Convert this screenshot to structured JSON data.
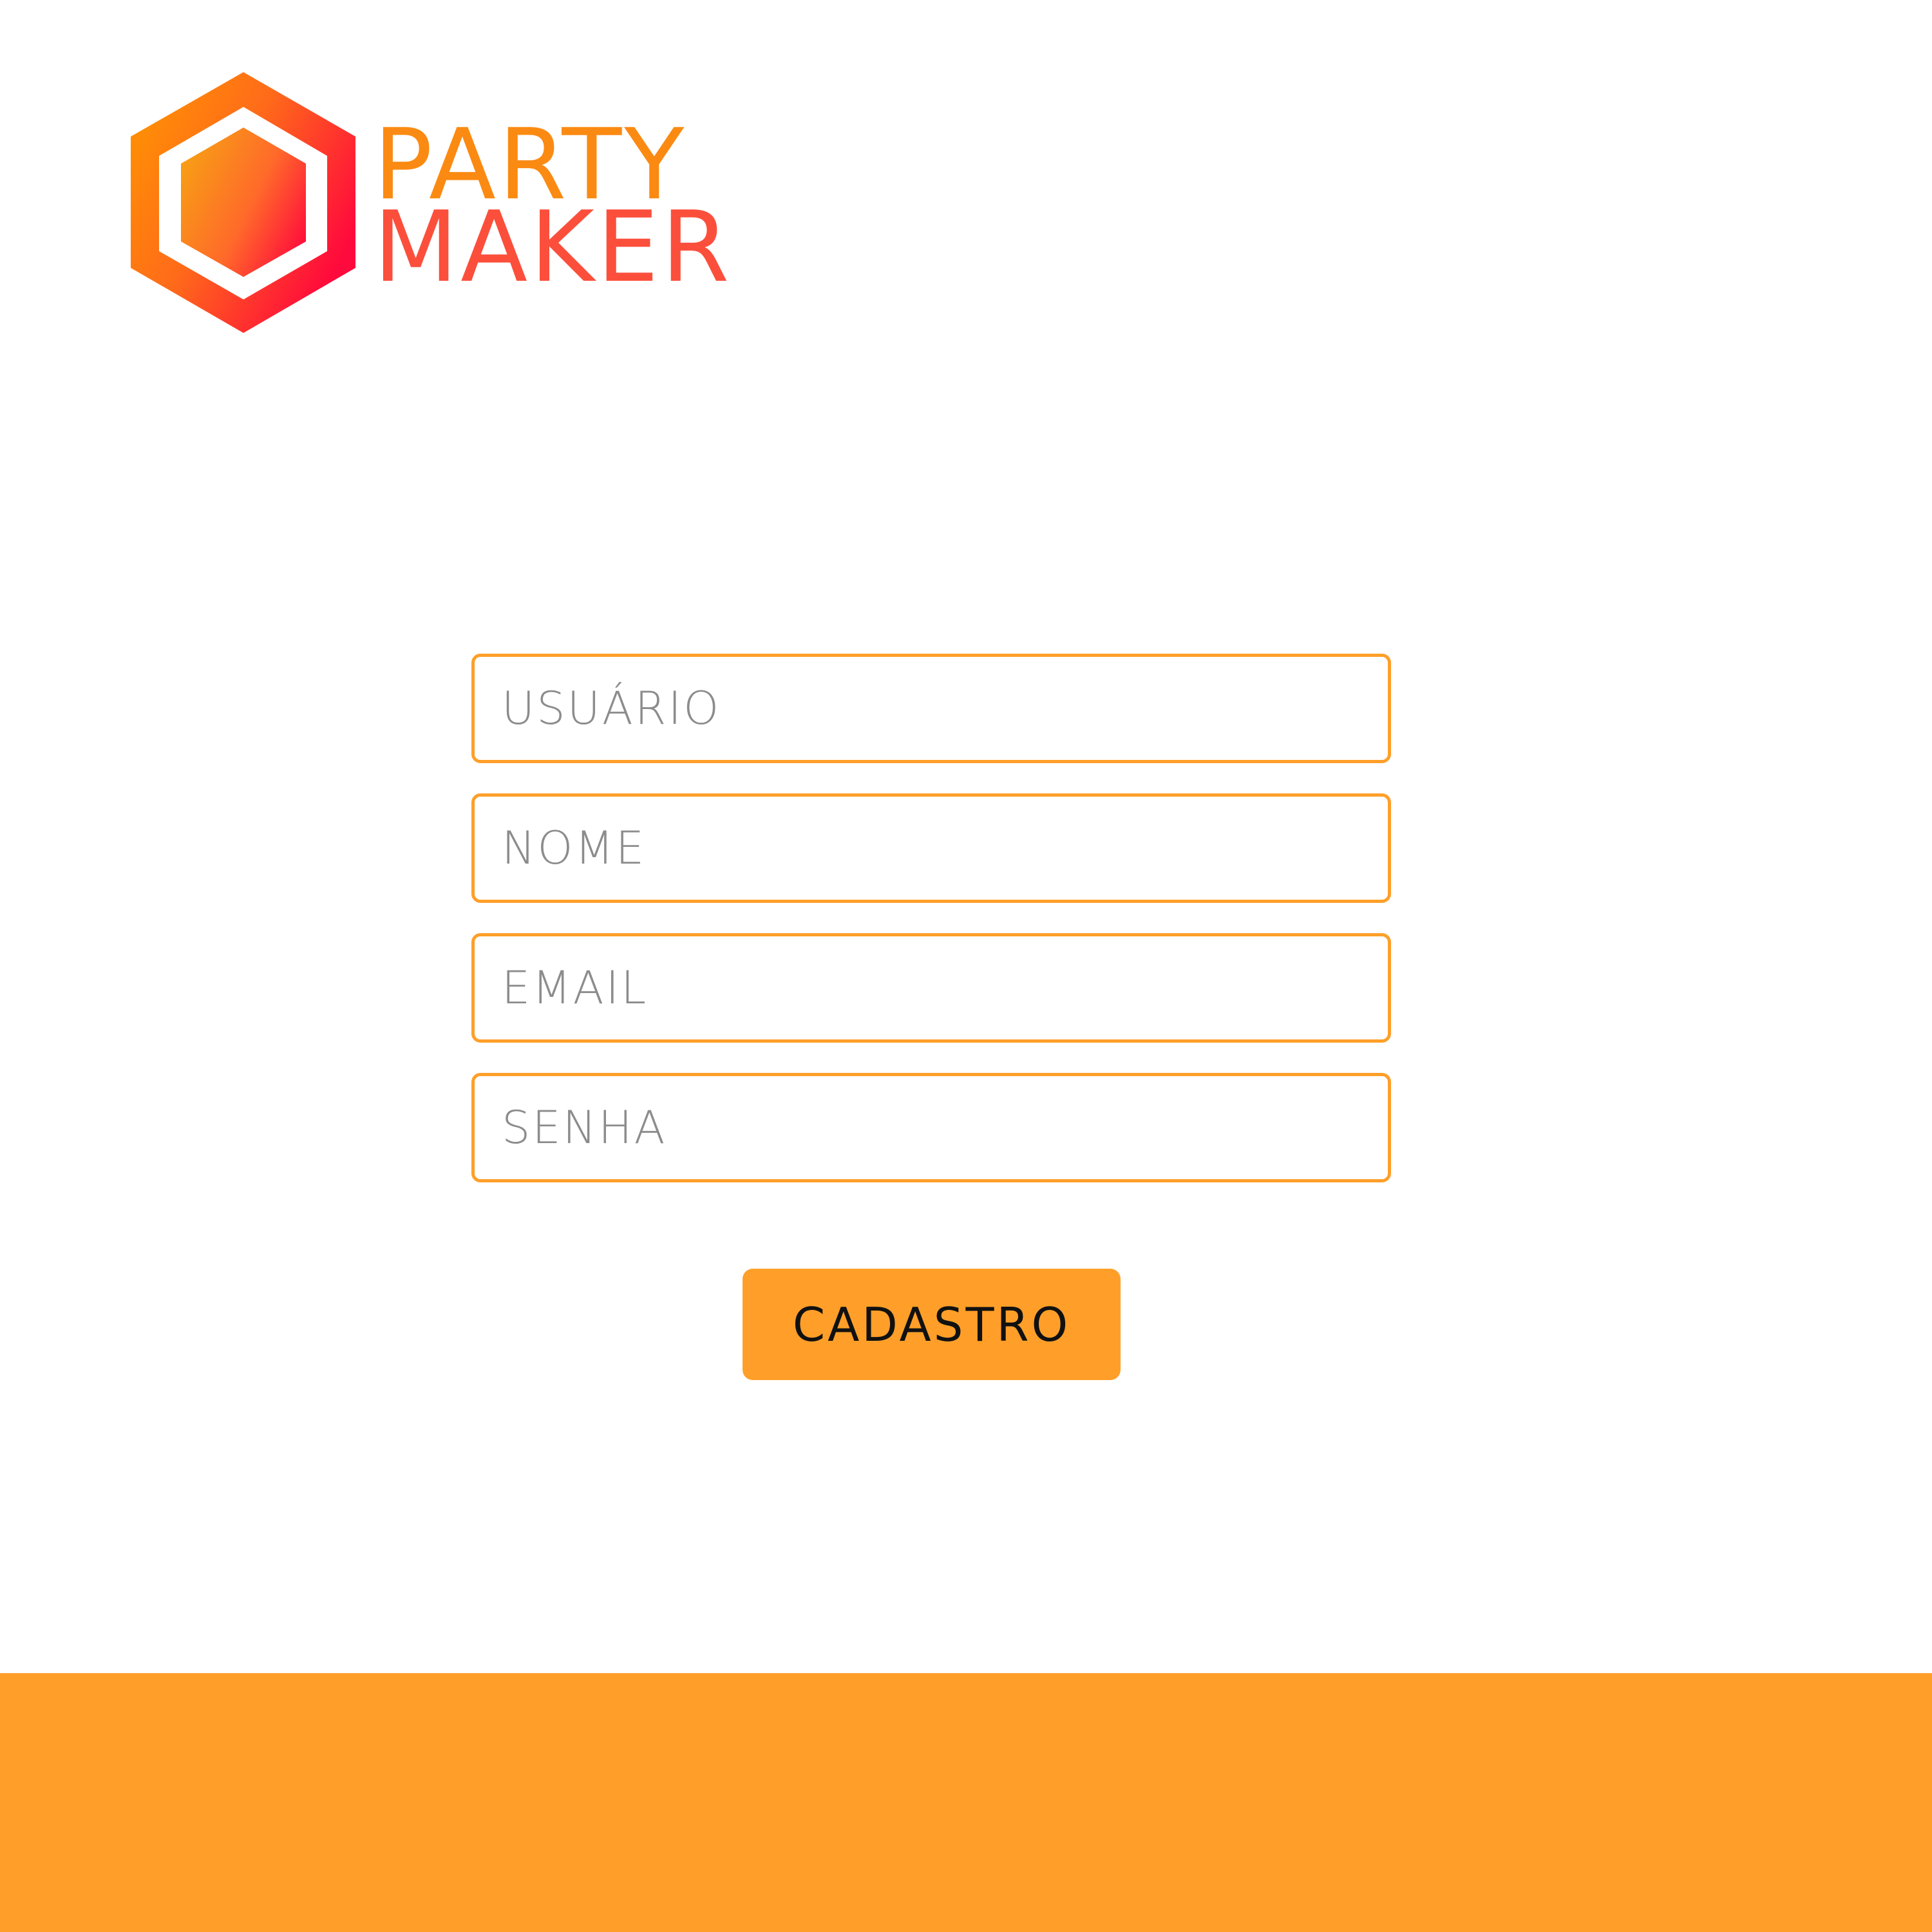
{
  "brand": {
    "line_1": "PARTY",
    "line_2": "MAKER",
    "logo_icon": "hexagon-icon"
  },
  "form": {
    "usuario_placeholder": "USUÁRIO",
    "nome_placeholder": "NOME",
    "email_placeholder": "EMAIL",
    "senha_placeholder": "SENHA",
    "submit_label": "CADASTRO"
  },
  "colors": {
    "accent": "#ff9f29",
    "logo_gradient_start": "#ff9800",
    "logo_gradient_end": "#ff0a3c",
    "placeholder_text": "#8c8c8c",
    "button_text": "#111111",
    "background": "#ffffff"
  }
}
